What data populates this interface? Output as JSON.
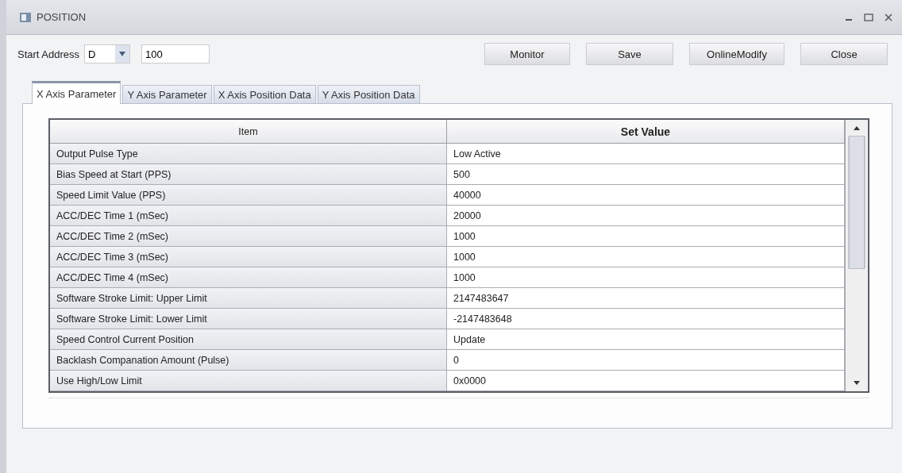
{
  "window": {
    "title": "POSITION"
  },
  "toolbar": {
    "label": "Start Address",
    "device": "D",
    "address": "100",
    "buttons": [
      "Monitor",
      "Save",
      "OnlineModify",
      "Close"
    ]
  },
  "tabs": [
    {
      "label": "X Axis Parameter",
      "selected": true
    },
    {
      "label": "Y Axis Parameter",
      "selected": false
    },
    {
      "label": "X Axis Position Data",
      "selected": false
    },
    {
      "label": "Y Axis Position Data",
      "selected": false
    }
  ],
  "table": {
    "columns": [
      "Item",
      "Set Value"
    ],
    "rows": [
      [
        "Output Pulse Type",
        "Low Active"
      ],
      [
        "Bias Speed at Start (PPS)",
        "500"
      ],
      [
        "Speed Limit Value (PPS)",
        "40000"
      ],
      [
        "ACC/DEC Time 1 (mSec)",
        "20000"
      ],
      [
        "ACC/DEC Time 2 (mSec)",
        "1000"
      ],
      [
        "ACC/DEC Time 3 (mSec)",
        "1000"
      ],
      [
        "ACC/DEC Time 4 (mSec)",
        "1000"
      ],
      [
        "Software Stroke Limit: Upper Limit",
        "2147483647"
      ],
      [
        "Software Stroke Limit: Lower Limit",
        "-2147483648"
      ],
      [
        "Speed Control Current Position",
        "Update"
      ],
      [
        "Backlash Companation Amount (Pulse)",
        "0"
      ],
      [
        "Use High/Low Limit",
        "0x0000"
      ]
    ]
  }
}
